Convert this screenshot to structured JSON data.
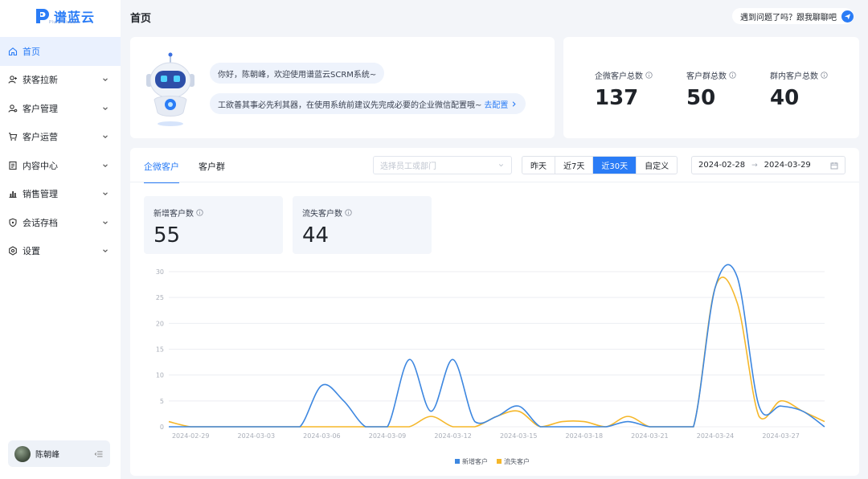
{
  "brand": {
    "name": "谱蓝云",
    "sub": "Plum Cloud"
  },
  "sidebar": {
    "items": [
      {
        "label": "首页",
        "icon": "home-icon",
        "active": true
      },
      {
        "label": "获客拉新",
        "icon": "user-plus-icon"
      },
      {
        "label": "客户管理",
        "icon": "user-icon"
      },
      {
        "label": "客户运营",
        "icon": "cart-icon"
      },
      {
        "label": "内容中心",
        "icon": "document-icon"
      },
      {
        "label": "销售管理",
        "icon": "bar-chart-icon"
      },
      {
        "label": "会话存档",
        "icon": "shield-icon"
      },
      {
        "label": "设置",
        "icon": "settings-icon"
      }
    ],
    "user": {
      "name": "陈朝峰"
    }
  },
  "header": {
    "title": "首页",
    "help_text": "遇到问题了吗？跟我聊聊吧"
  },
  "welcome": {
    "greeting": "你好，陈朝峰，欢迎使用谱蓝云SCRM系统~",
    "tip": "工欲善其事必先利其器，在使用系统前建议先完成必要的企业微信配置哦~",
    "tip_link": "去配置"
  },
  "stats": [
    {
      "label": "企微客户总数",
      "value": "137"
    },
    {
      "label": "客户群总数",
      "value": "50"
    },
    {
      "label": "群内客户总数",
      "value": "40"
    }
  ],
  "panel": {
    "tabs": [
      {
        "label": "企微客户",
        "active": true
      },
      {
        "label": "客户群"
      }
    ],
    "dept_placeholder": "选择员工或部门",
    "ranges": [
      {
        "label": "昨天"
      },
      {
        "label": "近7天"
      },
      {
        "label": "近30天",
        "active": true
      },
      {
        "label": "自定义"
      }
    ],
    "date_start": "2024-02-28",
    "date_end": "2024-03-29",
    "kpis": [
      {
        "label": "新增客户数",
        "value": "55"
      },
      {
        "label": "流失客户数",
        "value": "44"
      }
    ]
  },
  "chart_data": {
    "type": "line",
    "x": [
      "2024-02-28",
      "2024-02-29",
      "2024-03-01",
      "2024-03-02",
      "2024-03-03",
      "2024-03-04",
      "2024-03-05",
      "2024-03-06",
      "2024-03-07",
      "2024-03-08",
      "2024-03-09",
      "2024-03-10",
      "2024-03-11",
      "2024-03-12",
      "2024-03-13",
      "2024-03-14",
      "2024-03-15",
      "2024-03-16",
      "2024-03-17",
      "2024-03-18",
      "2024-03-19",
      "2024-03-20",
      "2024-03-21",
      "2024-03-22",
      "2024-03-23",
      "2024-03-24",
      "2024-03-25",
      "2024-03-26",
      "2024-03-27",
      "2024-03-28",
      "2024-03-29"
    ],
    "x_tick_labels": [
      "2024-02-29",
      "2024-03-03",
      "2024-03-06",
      "2024-03-09",
      "2024-03-12",
      "2024-03-15",
      "2024-03-18",
      "2024-03-21",
      "2024-03-24",
      "2024-03-27"
    ],
    "x_tick_indices": [
      1,
      4,
      7,
      10,
      13,
      16,
      19,
      22,
      25,
      28
    ],
    "ylim": [
      0,
      30
    ],
    "yticks": [
      0,
      5,
      10,
      15,
      20,
      25,
      30
    ],
    "series": [
      {
        "name": "新增客户",
        "color": "#3d87e0",
        "values": [
          0,
          0,
          0,
          0,
          0,
          0,
          0,
          8,
          5,
          0,
          0,
          13,
          3,
          13,
          1,
          2,
          4,
          0,
          0,
          0,
          0,
          1,
          0,
          0,
          0,
          27,
          29,
          4,
          4,
          3,
          0
        ]
      },
      {
        "name": "流失客户",
        "color": "#f5b72a",
        "values": [
          1,
          0,
          0,
          0,
          0,
          0,
          0,
          0,
          0,
          0,
          0,
          0,
          2,
          0,
          0,
          2,
          3,
          0,
          1,
          1,
          0,
          2,
          0,
          0,
          0,
          27,
          24,
          2,
          5,
          3,
          1
        ]
      }
    ],
    "grid": true,
    "legend": "bottom-center"
  }
}
